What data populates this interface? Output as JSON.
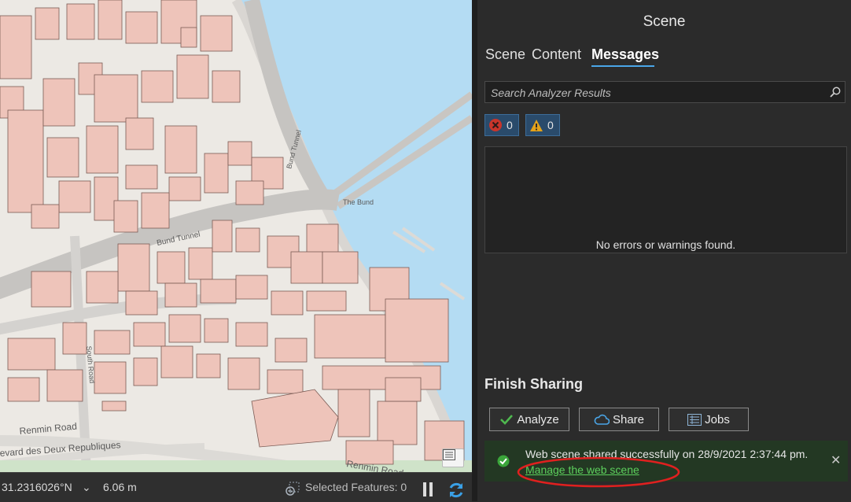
{
  "map": {
    "labels": {
      "bund_tunnel_vertical": "Bund Tunnel",
      "bund_tunnel_horizontal": "Bund Tunnel",
      "the_bund": "The Bund",
      "south_road": "South Road",
      "renmin_road_1": "Renmin Road",
      "renmin_road_2": "Renmin Road",
      "deux_republiques": "evard des Deux Republiques"
    }
  },
  "statusbar": {
    "coordinate": "31.2316026°N",
    "dropdown_glyph": "⌄",
    "elevation": "6.06 m",
    "selected_features": "Selected Features: 0"
  },
  "panel": {
    "title": "Scene",
    "tabs": [
      {
        "label": "Scene"
      },
      {
        "label": "Content"
      },
      {
        "label": "Messages"
      }
    ],
    "search": {
      "placeholder": "Search Analyzer Results"
    },
    "filters": {
      "errors": "0",
      "warnings": "0"
    },
    "messages_empty": "No errors or warnings found.",
    "finish": {
      "heading": "Finish Sharing",
      "analyze_label": "Analyze",
      "share_label": "Share",
      "jobs_label": "Jobs",
      "success_text": "Web scene shared successfully on 28/9/2021 2:37:44 pm.",
      "success_link": "Manage the web scene",
      "close_glyph": "✕"
    }
  },
  "colors": {
    "accent": "#4aa6e8",
    "water": "#b4dcf3",
    "building": "#eec4ba",
    "success_bg": "#233823",
    "link": "#5ccf5c",
    "annotation": "#e0201f"
  }
}
